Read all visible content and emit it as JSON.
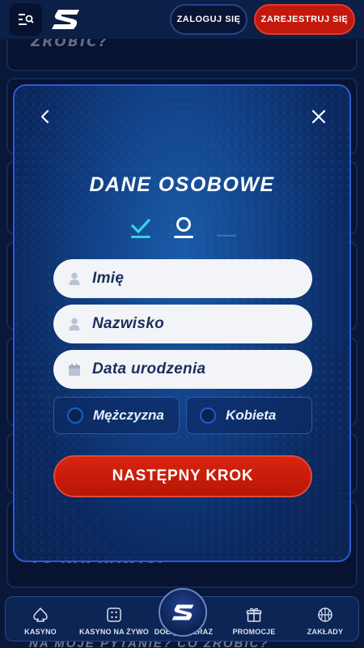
{
  "header": {
    "login_label": "ZALOGUJ SIĘ",
    "register_label": "ZAREJESTRUJ SIĘ"
  },
  "background": {
    "card_top_text": "ZROBIĆ?",
    "card_bottom_text": "TO NAPRAWIĆ?",
    "under_nav_text": "NA MOJE PYTANIE? CO ZROBIĆ?"
  },
  "modal": {
    "title": "DANE OSOBOWE",
    "first_name_placeholder": "Imię",
    "last_name_placeholder": "Nazwisko",
    "birthdate_placeholder": "Data urodzenia",
    "gender_male": "Mężczyzna",
    "gender_female": "Kobieta",
    "next_button": "NASTĘPNY KROK"
  },
  "bottom_nav": {
    "items": [
      {
        "label": "KASYNO",
        "icon": "spade-icon"
      },
      {
        "label": "KASYNO NA ŻYWO",
        "icon": "dice-icon"
      },
      {
        "label": "DOŁĄCZ TERAZ",
        "icon": "logo-icon"
      },
      {
        "label": "PROMOCJE",
        "icon": "gift-icon"
      },
      {
        "label": "ZAKŁADY",
        "icon": "basketball-icon"
      }
    ]
  },
  "colors": {
    "accent_red": "#c3180c",
    "accent_blue": "#2c5bd1",
    "step_done": "#32d6e8"
  }
}
